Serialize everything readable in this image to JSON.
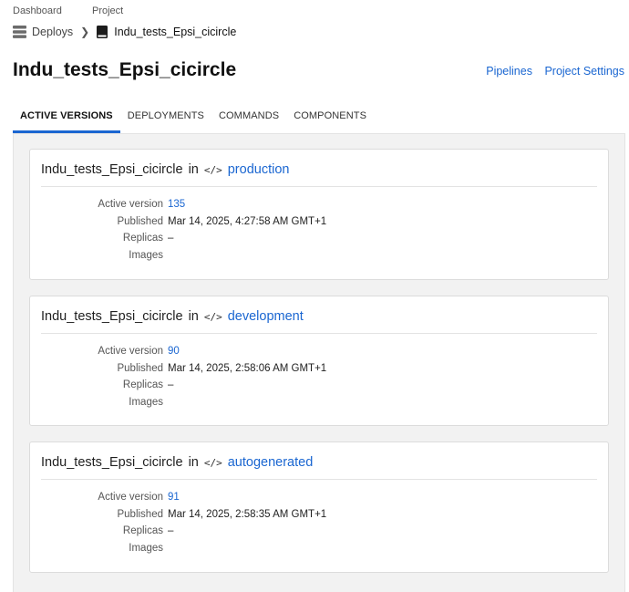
{
  "breadcrumb": {
    "dashboard_label": "Dashboard",
    "project_label": "Project",
    "deploys": "Deploys",
    "project_name": "Indu_tests_Epsi_cicircle"
  },
  "page_title": "Indu_tests_Epsi_cicircle",
  "header_links": {
    "pipelines": "Pipelines",
    "project_settings": "Project Settings"
  },
  "tabs": [
    {
      "label": "ACTIVE VERSIONS",
      "active": true
    },
    {
      "label": "DEPLOYMENTS",
      "active": false
    },
    {
      "label": "COMMANDS",
      "active": false
    },
    {
      "label": "COMPONENTS",
      "active": false
    }
  ],
  "labels": {
    "in": "in",
    "active_version": "Active version",
    "published": "Published",
    "replicas": "Replicas",
    "images": "Images"
  },
  "environments": [
    {
      "project": "Indu_tests_Epsi_cicircle",
      "env": "production",
      "active_version": "135",
      "published": "Mar 14, 2025, 4:27:58 AM GMT+1",
      "replicas": "–",
      "images": ""
    },
    {
      "project": "Indu_tests_Epsi_cicircle",
      "env": "development",
      "active_version": "90",
      "published": "Mar 14, 2025, 2:58:06 AM GMT+1",
      "replicas": "–",
      "images": ""
    },
    {
      "project": "Indu_tests_Epsi_cicircle",
      "env": "autogenerated",
      "active_version": "91",
      "published": "Mar 14, 2025, 2:58:35 AM GMT+1",
      "replicas": "–",
      "images": ""
    }
  ],
  "colors": {
    "accent": "#1a66d1",
    "panel_bg": "#f2f2f2"
  }
}
